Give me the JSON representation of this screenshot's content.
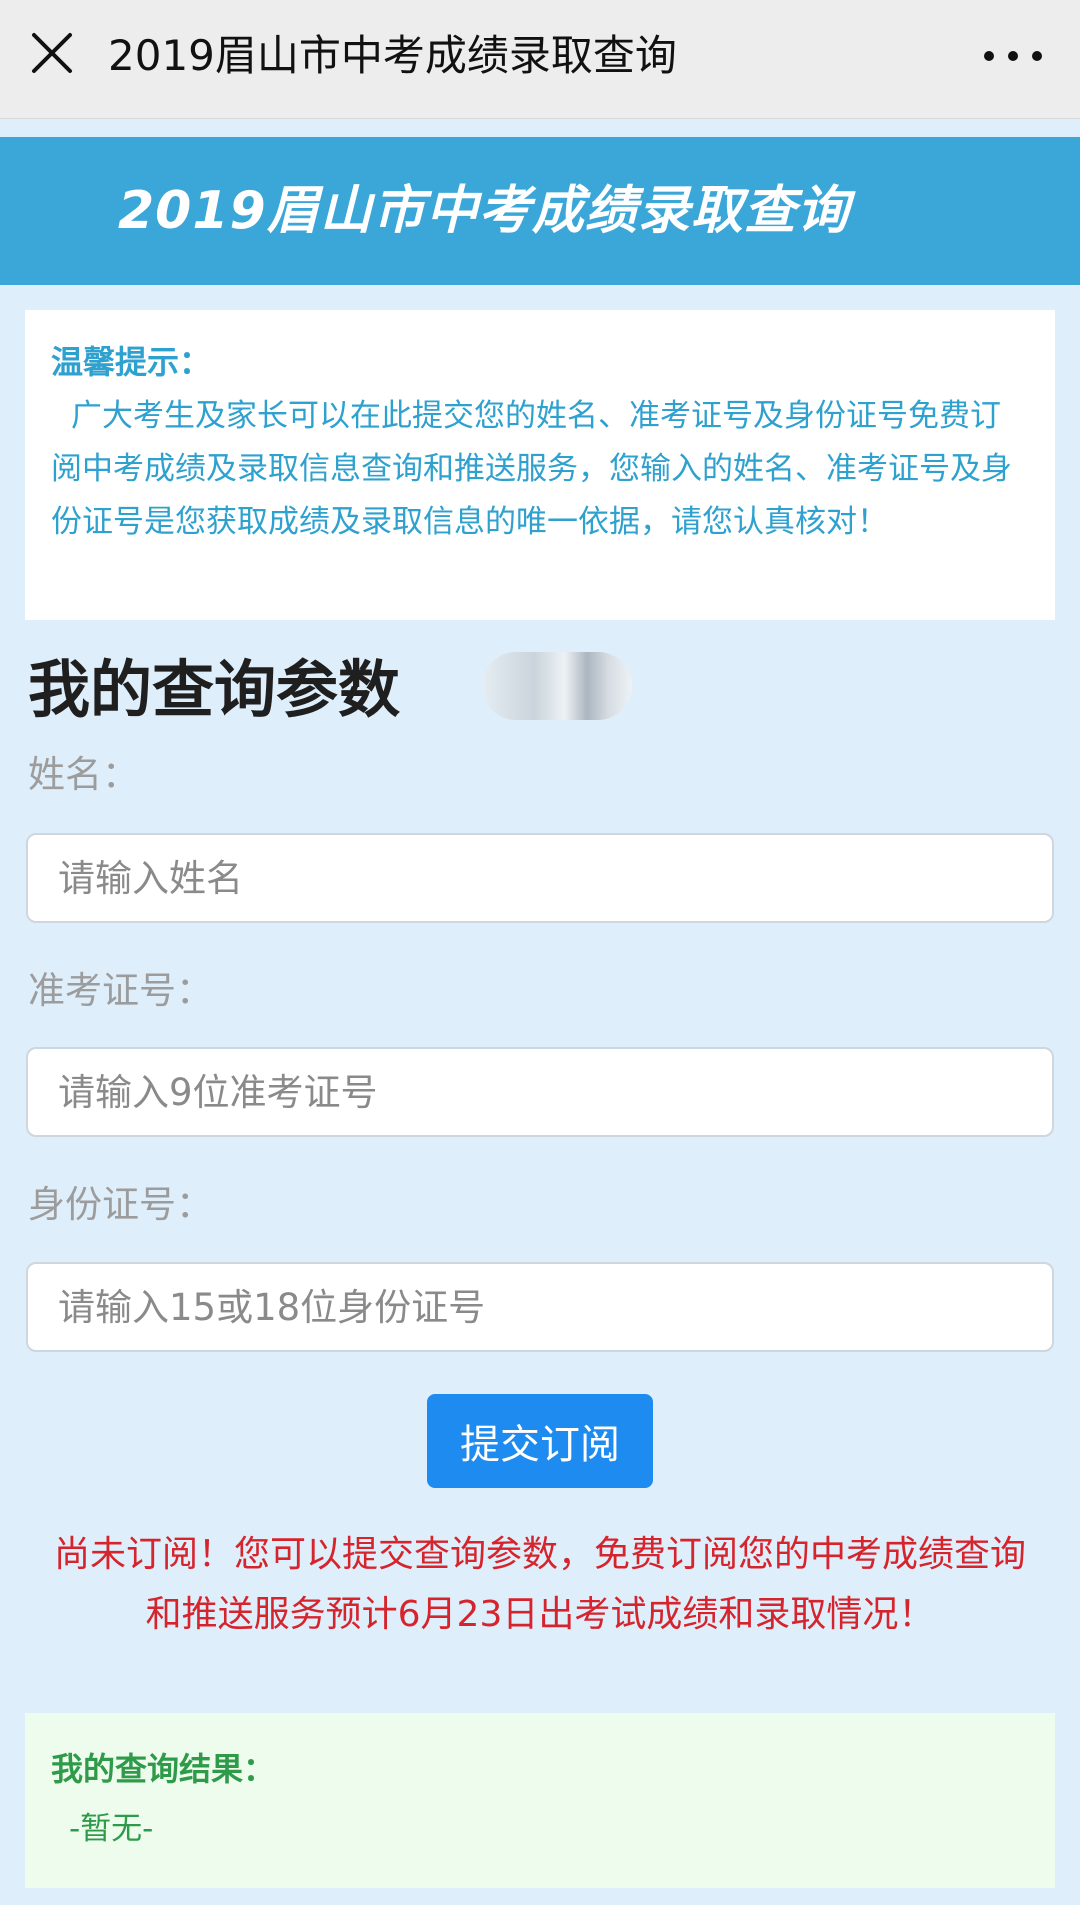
{
  "topbar": {
    "title": "2019眉山市中考成绩录取查询",
    "close_icon": "close-icon",
    "more_icon": "more-icon"
  },
  "banner": {
    "title": "2019眉山市中考成绩录取查询"
  },
  "notice": {
    "title": "温馨提示：",
    "body": "广大考生及家长可以在此提交您的姓名、准考证号及身份证号免费订阅中考成绩及录取信息查询和推送服务，您输入的姓名、准考证号及身份证号是您获取成绩及录取信息的唯一依据，请您认真核对！"
  },
  "query": {
    "section_title": "我的查询参数",
    "name_label": "姓名：",
    "name_placeholder": "请输入姓名",
    "name_value": "",
    "exam_label": "准考证号：",
    "exam_placeholder": "请输入9位准考证号",
    "exam_value": "",
    "id_label": "身份证号：",
    "id_placeholder": "请输入15或18位身份证号",
    "id_value": "",
    "submit_label": "提交订阅"
  },
  "status": {
    "message": "尚未订阅！您可以提交查询参数，免费订阅您的中考成绩查询和推送服务预计6月23日出考试成绩和录取情况！"
  },
  "result": {
    "title": "我的查询结果：",
    "value": "-暂无-"
  },
  "colors": {
    "page_bg": "#dfeefb",
    "banner_bg": "#3aa7d8",
    "notice_text": "#2fa1cf",
    "button_bg": "#1e8bf0",
    "status_text": "#d6242d",
    "result_text": "#2f9b4a",
    "result_bg": "#eefced"
  }
}
